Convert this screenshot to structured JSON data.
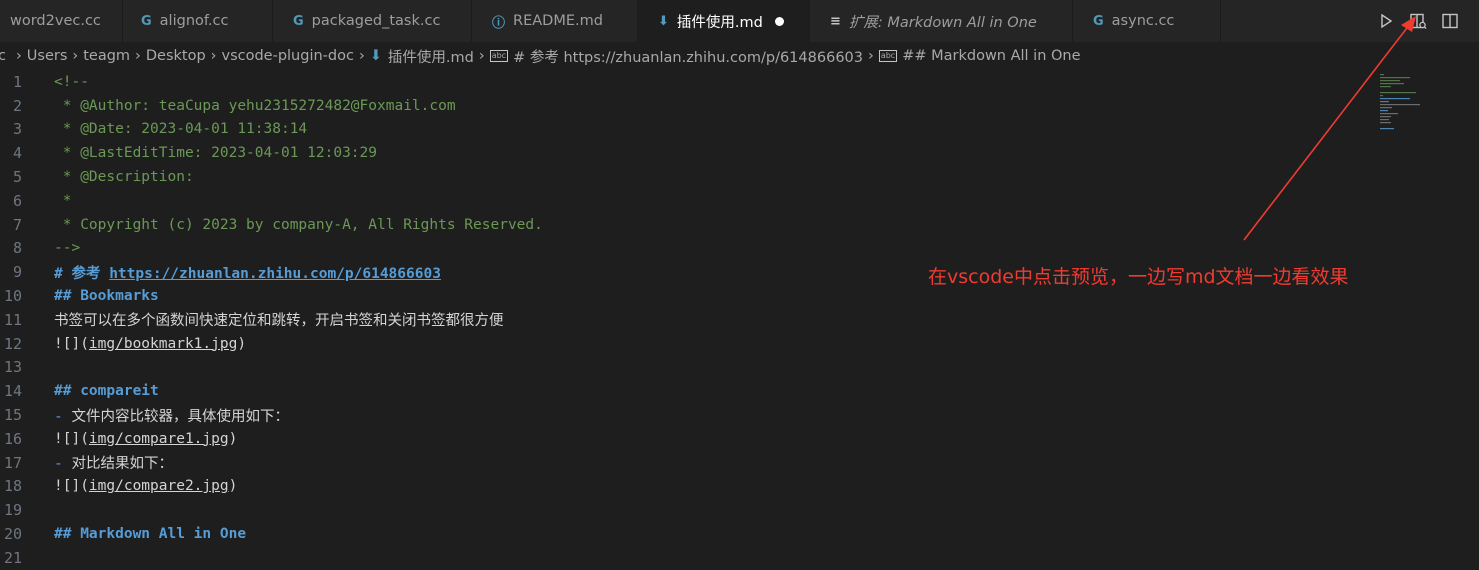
{
  "tabs": [
    {
      "label": "word2vec.cc",
      "icon": "",
      "icon_color": "#519aba"
    },
    {
      "label": "alignof.cc",
      "icon": "G",
      "icon_color": "#519aba"
    },
    {
      "label": "packaged_task.cc",
      "icon": "G",
      "icon_color": "#519aba"
    },
    {
      "label": "README.md",
      "icon": "ⓘ",
      "icon_color": "#519aba"
    },
    {
      "label": "插件使用.md",
      "icon": "⬇",
      "icon_color": "#519aba"
    },
    {
      "label": "扩展: Markdown All in One",
      "icon": "≡",
      "icon_color": "#c5c5c5"
    },
    {
      "label": "async.cc",
      "icon": "G",
      "icon_color": "#519aba"
    }
  ],
  "breadcrumb": [
    "Users",
    "teagm",
    "Desktop",
    "vscode-plugin-doc",
    "插件使用.md",
    "# 参考 https://zhuanlan.zhihu.com/p/614866603",
    "## Markdown All in One"
  ],
  "lines": [
    {
      "n": "1",
      "segs": [
        {
          "t": "<!--",
          "c": "c-comment"
        }
      ]
    },
    {
      "n": "2",
      "segs": [
        {
          "t": " * @Author: teaCupa yehu2315272482@Foxmail.com",
          "c": "c-comment"
        }
      ]
    },
    {
      "n": "3",
      "segs": [
        {
          "t": " * @Date: 2023-04-01 11:38:14",
          "c": "c-comment"
        }
      ]
    },
    {
      "n": "4",
      "segs": [
        {
          "t": " * @LastEditTime: 2023-04-01 12:03:29",
          "c": "c-comment"
        }
      ]
    },
    {
      "n": "5",
      "segs": [
        {
          "t": " * @Description:",
          "c": "c-comment"
        }
      ]
    },
    {
      "n": "6",
      "segs": [
        {
          "t": " *",
          "c": "c-comment"
        }
      ]
    },
    {
      "n": "7",
      "segs": [
        {
          "t": " * Copyright (c) 2023 by company-A, All Rights Reserved.",
          "c": "c-comment"
        }
      ]
    },
    {
      "n": "8",
      "segs": [
        {
          "t": "-->",
          "c": "c-comment"
        }
      ]
    },
    {
      "n": "9",
      "segs": [
        {
          "t": "# 参考 ",
          "c": "c-heading"
        },
        {
          "t": "https://zhuanlan.zhihu.com/p/614866603",
          "c": "c-link"
        }
      ]
    },
    {
      "n": "10",
      "segs": [
        {
          "t": "## Bookmarks",
          "c": "c-heading"
        }
      ]
    },
    {
      "n": "11",
      "segs": [
        {
          "t": "书签可以在多个函数间快速定位和跳转，开启书签和关闭书签都很方便",
          "c": "c-plain cjk"
        }
      ]
    },
    {
      "n": "12",
      "segs": [
        {
          "t": "![](",
          "c": "c-plain"
        },
        {
          "t": "img/bookmark1.jpg",
          "c": "c-img"
        },
        {
          "t": ")",
          "c": "c-plain"
        }
      ]
    },
    {
      "n": "13",
      "segs": []
    },
    {
      "n": "14",
      "segs": [
        {
          "t": "## compareit",
          "c": "c-heading"
        }
      ]
    },
    {
      "n": "15",
      "segs": [
        {
          "t": "- ",
          "c": "c-bullet"
        },
        {
          "t": "文件内容比较器，具体使用如下：",
          "c": "c-plain cjk"
        }
      ]
    },
    {
      "n": "16",
      "segs": [
        {
          "t": "![](",
          "c": "c-plain"
        },
        {
          "t": "img/compare1.jpg",
          "c": "c-img"
        },
        {
          "t": ")",
          "c": "c-plain"
        }
      ]
    },
    {
      "n": "17",
      "segs": [
        {
          "t": "- ",
          "c": "c-bullet"
        },
        {
          "t": "对比结果如下：",
          "c": "c-plain cjk"
        }
      ]
    },
    {
      "n": "18",
      "segs": [
        {
          "t": "![](",
          "c": "c-plain"
        },
        {
          "t": "img/compare2.jpg",
          "c": "c-img"
        },
        {
          "t": ")",
          "c": "c-plain"
        }
      ]
    },
    {
      "n": "19",
      "segs": []
    },
    {
      "n": "20",
      "segs": [
        {
          "t": "## Markdown All in One",
          "c": "c-heading"
        }
      ]
    },
    {
      "n": "21",
      "segs": []
    }
  ],
  "annotation": {
    "text": "在vscode中点击预览，一边写md文档一边看效果",
    "color": "#f03b30"
  },
  "colors": {
    "editor_bg": "#1e1e1e",
    "tabbar_bg": "#252526",
    "comment": "#6a9955",
    "heading": "#569cd6"
  }
}
